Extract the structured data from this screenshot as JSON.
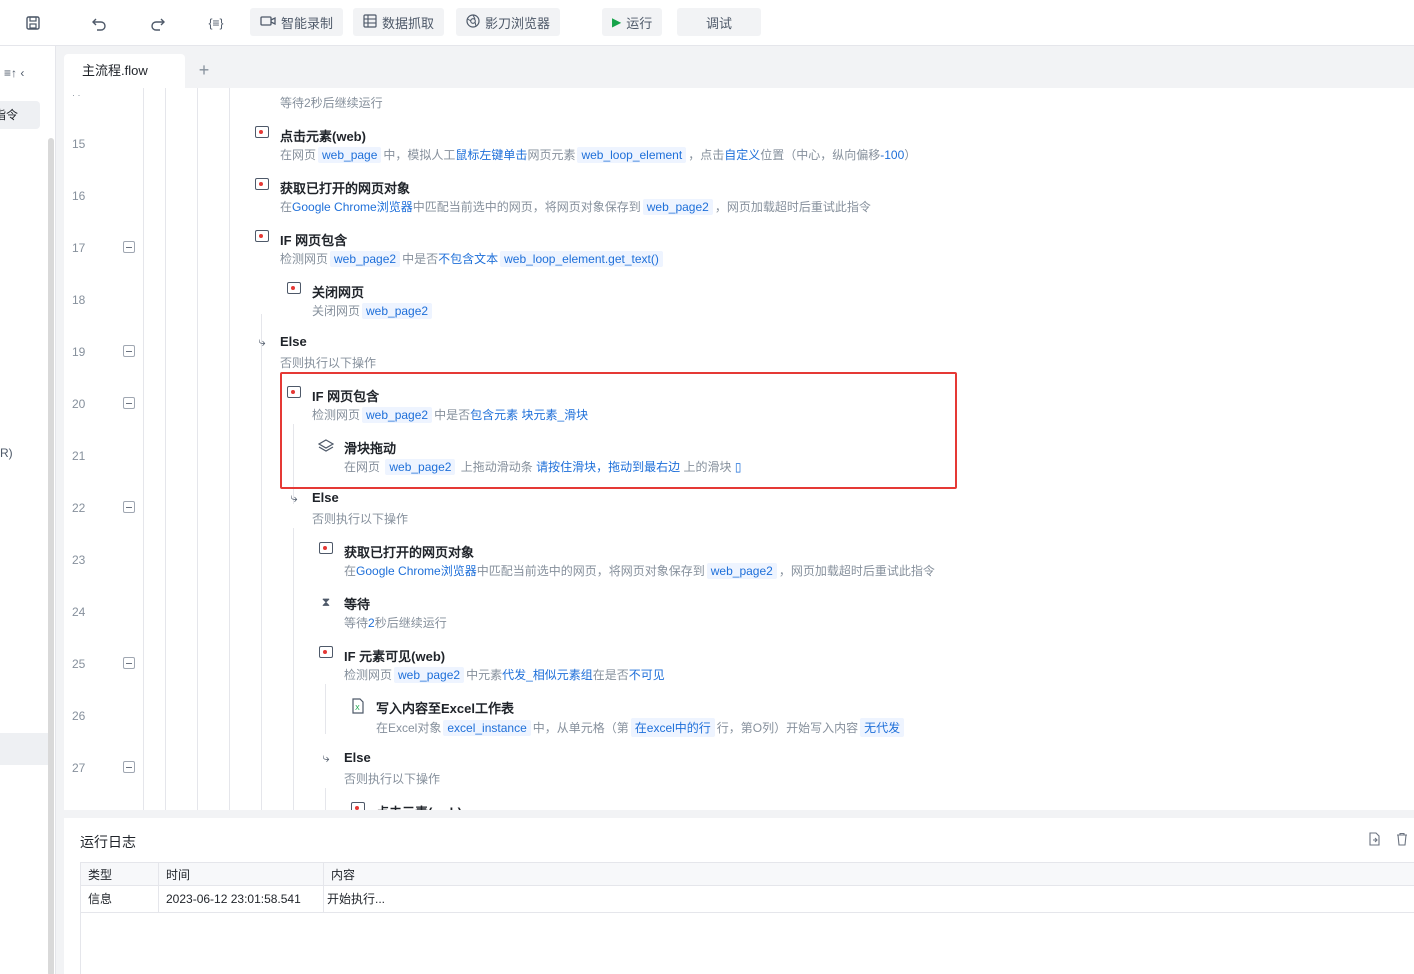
{
  "toolbar": {
    "icons": [
      "save-icon",
      "undo-icon",
      "redo-icon",
      "variable-icon"
    ],
    "variable_glyph": "{≡}",
    "record_label": "智能录制",
    "scrape_label": "数据抓取",
    "browser_label": "影刀浏览器",
    "run_label": "运行",
    "debug_label": "调试"
  },
  "left_panel": {
    "top_text": "≡↑  ‹",
    "selected_item": "指令",
    "side_text": "R)"
  },
  "tabs": {
    "active": "主流程.flow",
    "add": "+"
  },
  "editor": {
    "line_numbers": [
      "15",
      "16",
      "17",
      "18",
      "19",
      "20",
      "21",
      "22",
      "23",
      "24",
      "25",
      "26",
      "27"
    ],
    "top_partial_desc": "等待2秒后继续运行",
    "steps": {
      "s15": {
        "title": "点击元素(web)",
        "d1": "在网页",
        "c1": "web_page",
        "d2": "中，模拟人工",
        "b1": "鼠标左键单击",
        "d3": "网页元素",
        "c2": "web_loop_element",
        "d4": "，点击",
        "b2": "自定义",
        "d5": "位置（中心，纵向偏移",
        "b3": "-100",
        "d6": "）"
      },
      "s16": {
        "title": "获取已打开的网页对象",
        "d1": "在",
        "b1": "Google Chrome浏览器",
        "d2": "中匹配当前选中的网页，将网页对象保存到",
        "c1": "web_page2",
        "d3": "，网页加载超时后重试此指令"
      },
      "s17": {
        "title": "IF 网页包含",
        "d1": "检测网页",
        "c1": "web_page2",
        "d2": "中是否",
        "b1": "不包含文本",
        "c2": "web_loop_element.get_text()"
      },
      "s18": {
        "title": "关闭网页",
        "d1": "关闭网页",
        "c1": "web_page2"
      },
      "s19": {
        "title": "Else",
        "d1": "否则执行以下操作"
      },
      "s20": {
        "title": "IF 网页包含",
        "d1": "检测网页",
        "c1": "web_page2",
        "d2": "中是否",
        "b1": "包含元素",
        "b2": "块元素_滑块"
      },
      "s21": {
        "title": "滑块拖动",
        "d1": "在网页",
        "c1": "web_page2",
        "d2": "上拖动滑动条",
        "b1": "请按住滑块，拖动到最右边",
        "d3": "上的滑块",
        "b2": "▯"
      },
      "s22": {
        "title": "Else",
        "d1": "否则执行以下操作"
      },
      "s23": {
        "title": "获取已打开的网页对象",
        "d1": "在",
        "b1": "Google Chrome浏览器",
        "d2": "中匹配当前选中的网页，将网页对象保存到",
        "c1": "web_page2",
        "d3": "，网页加载超时后重试此指令"
      },
      "s24": {
        "title": "等待",
        "d1": "等待",
        "b1": "2",
        "d2": "秒后继续运行"
      },
      "s25": {
        "title": "IF 元素可见(web)",
        "d1": "检测网页",
        "c1": "web_page2",
        "d2": "中元素",
        "b1": "代发_相似元素组",
        "d3": "在是否",
        "b2": "不可见"
      },
      "s26": {
        "title": "写入内容至Excel工作表",
        "d1": "在Excel对象",
        "c1": "excel_instance",
        "d2": "中，从单元格（第",
        "c2": "在excel中的行",
        "d3": "行，第",
        "b1": "O",
        "d4": "列）开始写入内容",
        "c3": "无代发"
      },
      "s27": {
        "title": "Else",
        "d1": "否则执行以下操作"
      },
      "s28_partial": {
        "title": "点击元素(web)"
      }
    }
  },
  "log": {
    "title": "运行日志",
    "columns": [
      "类型",
      "时间",
      "内容"
    ],
    "rows": [
      {
        "type": "信息",
        "time": "2023-06-12 23:01:58.541",
        "content": "开始执行..."
      }
    ]
  }
}
